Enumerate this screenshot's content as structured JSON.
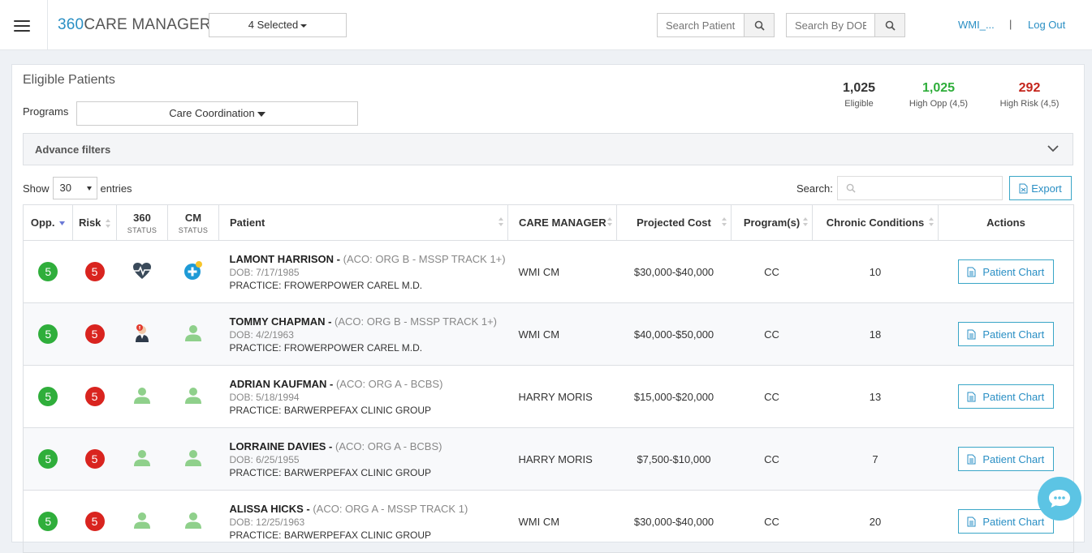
{
  "header": {
    "brand_num": "360",
    "brand_text": "CARE MANAGER",
    "selected_label": "4 Selected",
    "search_patient_placeholder": "Search Patient",
    "search_dob_placeholder": "Search By DOB",
    "user_label": "WMI_...",
    "separator": "|",
    "logout_label": "Log Out"
  },
  "panel": {
    "title": "Eligible Patients",
    "programs_label": "Programs",
    "programs_value": "Care Coordination",
    "stats": [
      {
        "value": "1,025",
        "label": "Eligible",
        "color": "#333333"
      },
      {
        "value": "1,025",
        "label": "High Opp (4,5)",
        "color": "#2fae3b"
      },
      {
        "value": "292",
        "label": "High Risk (4,5)",
        "color": "#c4251c"
      }
    ],
    "advance_filters_label": "Advance filters",
    "show_label": "Show",
    "entries_value": "30",
    "entries_label": "entries",
    "search_label": "Search:",
    "export_label": "Export"
  },
  "table": {
    "columns": {
      "opp": "Opp.",
      "risk": "Risk",
      "s360": "360",
      "s360_sub": "STATUS",
      "cm": "CM",
      "cm_sub": "STATUS",
      "patient": "Patient",
      "care_manager": "CARE MANAGER",
      "projected_cost": "Projected Cost",
      "programs": "Program(s)",
      "chronic": "Chronic Conditions",
      "actions": "Actions"
    },
    "rows": [
      {
        "opp": "5",
        "risk": "5",
        "name": "LAMONT HARRISON -",
        "aco": "(ACO: ORG B - MSSP TRACK 1+)",
        "dob": "DOB: 7/17/1985",
        "practice": "PRACTICE: FROWERPOWER CAREL M.D.",
        "care_manager": "WMI CM",
        "cost": "$30,000-$40,000",
        "program": "CC",
        "chronic": "10",
        "action": "Patient Chart"
      },
      {
        "opp": "5",
        "risk": "5",
        "name": "TOMMY CHAPMAN -",
        "aco": "(ACO: ORG B - MSSP TRACK 1+)",
        "dob": "DOB: 4/2/1963",
        "practice": "PRACTICE: FROWERPOWER CAREL M.D.",
        "care_manager": "WMI CM",
        "cost": "$40,000-$50,000",
        "program": "CC",
        "chronic": "18",
        "action": "Patient Chart"
      },
      {
        "opp": "5",
        "risk": "5",
        "name": "ADRIAN KAUFMAN -",
        "aco": "(ACO: ORG A - BCBS)",
        "dob": "DOB: 5/18/1994",
        "practice": "PRACTICE: BARWERPEFAX CLINIC GROUP",
        "care_manager": "HARRY MORIS",
        "cost": "$15,000-$20,000",
        "program": "CC",
        "chronic": "13",
        "action": "Patient Chart"
      },
      {
        "opp": "5",
        "risk": "5",
        "name": "LORRAINE DAVIES -",
        "aco": "(ACO: ORG A - BCBS)",
        "dob": "DOB: 6/25/1955",
        "practice": "PRACTICE: BARWERPEFAX CLINIC GROUP",
        "care_manager": "HARRY MORIS",
        "cost": "$7,500-$10,000",
        "program": "CC",
        "chronic": "7",
        "action": "Patient Chart"
      },
      {
        "opp": "5",
        "risk": "5",
        "name": "ALISSA HICKS -",
        "aco": "(ACO: ORG A - MSSP TRACK 1)",
        "dob": "DOB: 12/25/1963",
        "practice": "PRACTICE: BARWERPEFAX CLINIC GROUP",
        "care_manager": "WMI CM",
        "cost": "$30,000-$40,000",
        "program": "CC",
        "chronic": "20",
        "action": "Patient Chart"
      }
    ]
  },
  "icons": {
    "row0_360": "heart-pulse-icon",
    "row0_cm": "medical-plus-icon",
    "row1_360": "doctor-alert-icon",
    "default": "person-icon"
  },
  "colors": {
    "accent": "#2a8fc4",
    "green": "#2fae3b",
    "red": "#d9241f",
    "person_icon": "#8fd08b"
  }
}
